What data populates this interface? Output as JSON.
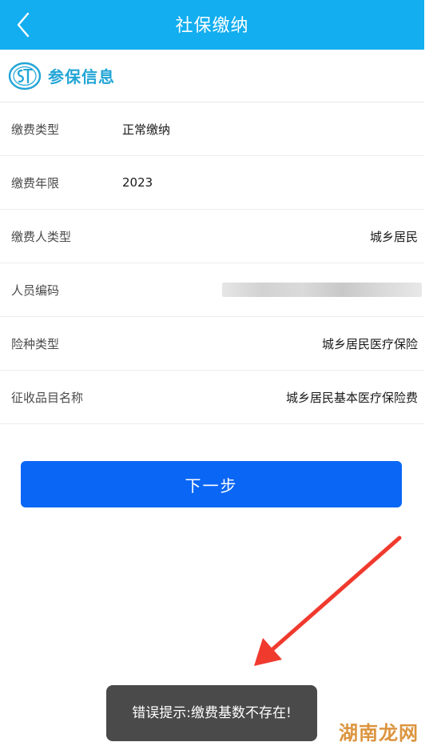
{
  "header": {
    "title": "社保缴纳"
  },
  "section": {
    "title": "参保信息"
  },
  "rows": [
    {
      "label": "缴费类型",
      "value": "正常缴纳",
      "align": "left"
    },
    {
      "label": "缴费年限",
      "value": "2023",
      "align": "left"
    },
    {
      "label": "缴费人类型",
      "value": "城乡居民",
      "align": "right"
    },
    {
      "label": "人员编码",
      "value": "",
      "align": "blurred"
    },
    {
      "label": "险种类型",
      "value": "城乡居民医疗保险",
      "align": "right"
    },
    {
      "label": "征收品目名称",
      "value": "城乡居民基本医疗保险费",
      "align": "right"
    }
  ],
  "next_button": {
    "label": "下一步"
  },
  "toast": {
    "message": "错误提示:缴费基数不存在!"
  },
  "watermark": {
    "text": "湖南龙网"
  },
  "colors": {
    "header": "#12aef0",
    "primary_button": "#0a66f5",
    "section_title": "#22a5d6",
    "arrow": "#f03a2e"
  }
}
